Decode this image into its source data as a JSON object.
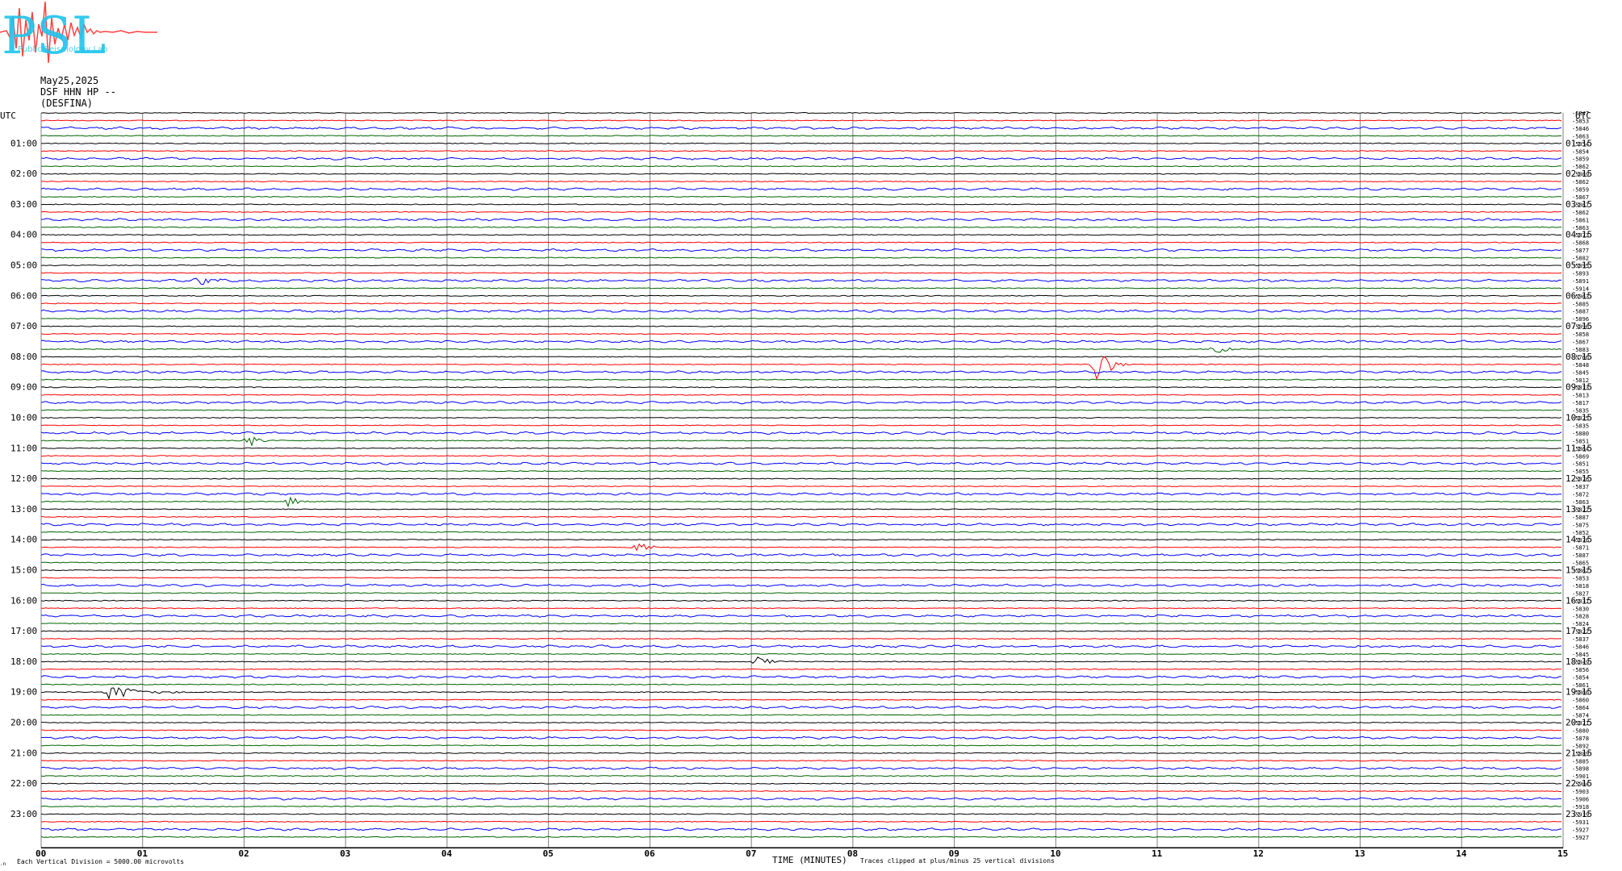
{
  "header": {
    "logo_text": "PSL",
    "logo_subtext": "Public Seismology Lab",
    "date": "May25,2025",
    "station": "DSF HHN HP --",
    "site": "(DESFINA)"
  },
  "colors": {
    "black": "#000000",
    "red": "#ff0000",
    "blue": "#0000ff",
    "green": "#006400",
    "grid": "#808080"
  },
  "chart_data": {
    "type": "line",
    "title": "May25,2025 DSF HHN HP -- (DESFINA)",
    "xlabel": "TIME (MINUTES)",
    "xlim": [
      0,
      15
    ],
    "x_ticks": [
      "00",
      "01",
      "02",
      "03",
      "04",
      "05",
      "06",
      "07",
      "08",
      "09",
      "10",
      "11",
      "12",
      "13",
      "14",
      "15"
    ],
    "left_label": "UTC",
    "right_label": "UTC",
    "left_hour_labels": [
      "01:00",
      "02:00",
      "03:00",
      "04:00",
      "05:00",
      "06:00",
      "07:00",
      "08:00",
      "09:00",
      "10:00",
      "11:00",
      "12:00",
      "13:00",
      "14:00",
      "15:00",
      "16:00",
      "17:00",
      "18:00",
      "19:00",
      "20:00",
      "21:00",
      "22:00",
      "23:00"
    ],
    "right_hour_labels": [
      "01:15",
      "02:15",
      "03:15",
      "04:15",
      "05:15",
      "06:15",
      "07:15",
      "08:15",
      "09:15",
      "10:15",
      "11:15",
      "12:15",
      "13:15",
      "14:15",
      "15:15",
      "16:15",
      "17:15",
      "18:15",
      "19:15",
      "20:15",
      "21:15",
      "22:15",
      "23:15"
    ],
    "trace_offsets": [
      "-5847",
      "-5853",
      "-5846",
      "-5863",
      "-5854",
      "-5854",
      "-5859",
      "-5862",
      "-5869",
      "-5862",
      "-5859",
      "-5867",
      "-5867",
      "-5862",
      "-5861",
      "-5863",
      "-5873",
      "-5868",
      "-5877",
      "-5882",
      "-5895",
      "-5893",
      "-5891",
      "-5914",
      "-5963",
      "-5885",
      "-5887",
      "-5896",
      "-5096",
      "-5858",
      "-5867",
      "-5883",
      "-5766",
      "-5848",
      "-5845",
      "-5812",
      "-5813",
      "-5813",
      "-5817",
      "-5835",
      "-5825",
      "-5835",
      "-5880",
      "-5851",
      "-5864",
      "-5869",
      "-5851",
      "-5855",
      "-5876",
      "-5837",
      "-5872",
      "-5863",
      "-5822",
      "-5887",
      "-5875",
      "-5852",
      "-5876",
      "-5871",
      "-5887",
      "-5865",
      "-5862",
      "-5853",
      "-5818",
      "-5827",
      "-5831",
      "-5830",
      "-5828",
      "-5824",
      "-5822",
      "-5837",
      "-5846",
      "-5845",
      "-5849",
      "-5856",
      "-5854",
      "-5861",
      "-5866",
      "-5860",
      "-5864",
      "-5874",
      "-5871",
      "-5880",
      "-5878",
      "-5892",
      "-5889",
      "-5885",
      "-5898",
      "-5901",
      "-5904",
      "-5903",
      "-5906",
      "-5918",
      "-5919",
      "-5931",
      "-5927",
      "-5927"
    ],
    "trace_color_cycle": [
      "black",
      "red",
      "blue",
      "green"
    ],
    "events": [
      {
        "trace": 22,
        "minute": 1.55,
        "amplitude": "small"
      },
      {
        "trace": 31,
        "minute": 11.55,
        "amplitude": "small"
      },
      {
        "trace": 33,
        "minute": 10.38,
        "amplitude": "large"
      },
      {
        "trace": 43,
        "minute": 2.05,
        "amplitude": "small"
      },
      {
        "trace": 51,
        "minute": 2.42,
        "amplitude": "small"
      },
      {
        "trace": 57,
        "minute": 5.85,
        "amplitude": "small"
      },
      {
        "trace": 72,
        "minute": 7.05,
        "amplitude": "small"
      },
      {
        "trace": 76,
        "minute": 0.65,
        "amplitude": "medium"
      }
    ],
    "grid": true
  },
  "footer": {
    "division_note": "Each Vertical Division = 5000.00 microvolts",
    "xlabel": "TIME (MINUTES)",
    "clip_note": "Traces clipped at plus/minus 25 vertical divisions",
    "corner_mark": ".n"
  }
}
